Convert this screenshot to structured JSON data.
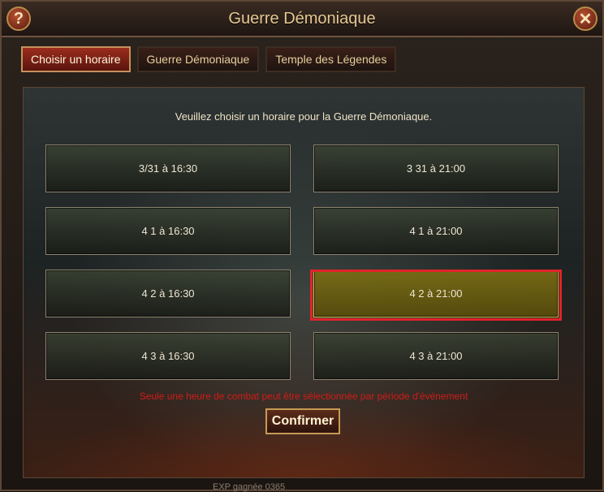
{
  "window": {
    "title": "Guerre Démoniaque",
    "help_glyph": "?",
    "close_glyph": "✕"
  },
  "tabs": [
    {
      "label": "Choisir un horaire",
      "active": true
    },
    {
      "label": "Guerre Démoniaque",
      "active": false
    },
    {
      "label": "Temple des Légendes",
      "active": false
    }
  ],
  "panel": {
    "instruction": "Veuillez choisir un horaire pour la Guerre Démoniaque.",
    "slots": [
      {
        "label": "3/31 à 16:30",
        "selected": false
      },
      {
        "label": "3 31 à 21:00",
        "selected": false
      },
      {
        "label": "4 1 à 16:30",
        "selected": false
      },
      {
        "label": "4 1 à 21:00",
        "selected": false
      },
      {
        "label": "4 2 à 16:30",
        "selected": false
      },
      {
        "label": "4 2 à 21:00",
        "selected": true
      },
      {
        "label": "4 3 à 16:30",
        "selected": false
      },
      {
        "label": "4 3 à 21:00",
        "selected": false
      }
    ],
    "notice": "Seule une heure de combat peut être sélectionnée par période d'événement",
    "confirm_label": "Confirmer"
  },
  "footer": {
    "partial_text": "EXP gagnée  0365"
  },
  "colors": {
    "accent_red": "#e1232a",
    "selected_slot": "#7d7014",
    "notice_red": "#d01c18"
  },
  "icons": {
    "help": "help-icon",
    "close": "close-icon"
  }
}
